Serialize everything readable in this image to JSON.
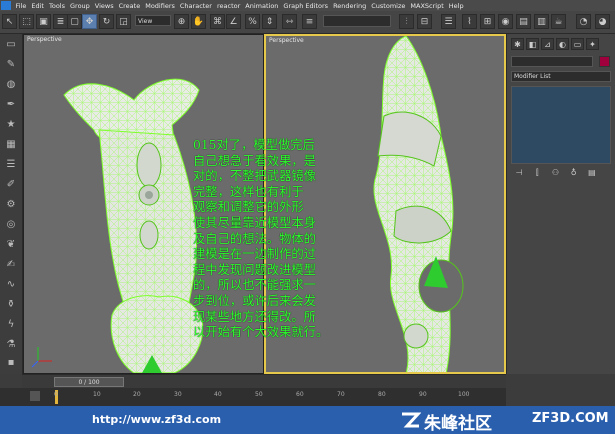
{
  "menu": [
    "File",
    "Edit",
    "Tools",
    "Group",
    "Views",
    "Create",
    "Modifiers",
    "Character",
    "reactor",
    "Animation",
    "Graph Editors",
    "Rendering",
    "Customize",
    "MAXScript",
    "Help"
  ],
  "toolbar": {
    "view_label": "View",
    "view_label2": "View"
  },
  "viewports": {
    "left_label": "Perspective",
    "right_label": "Perspective"
  },
  "command_panel": {
    "modifier_list": "Modifier List"
  },
  "timeline": {
    "frame_label": "0 / 100"
  },
  "track_ticks": [
    "0",
    "10",
    "20",
    "30",
    "40",
    "50",
    "60",
    "70",
    "80",
    "90",
    "100"
  ],
  "overlay_text": "015对了，模型做完后\n自己想急于看效果，是\n对的，不整把武器镜像\n完整，这样也有利于\n观察和调整它的外形\n使其尽量靠近模型本身\n及自己的想法。物体的\n建模是在一边制作的过\n程中发现问题改进模型\n的，所以也不能强求一\n步到位，或许后来会发\n现某些地方还得改。所\n以开始有个大效果就行。",
  "footer": {
    "url": "http://www.zf3d.com",
    "brand": "朱峰社区",
    "site": "ZF3D.COM"
  },
  "colors": {
    "accent_footer": "#2a5fae",
    "overlay_text": "#2dff2d",
    "wire": "#7dff2a",
    "mesh": "#e9ece6"
  }
}
